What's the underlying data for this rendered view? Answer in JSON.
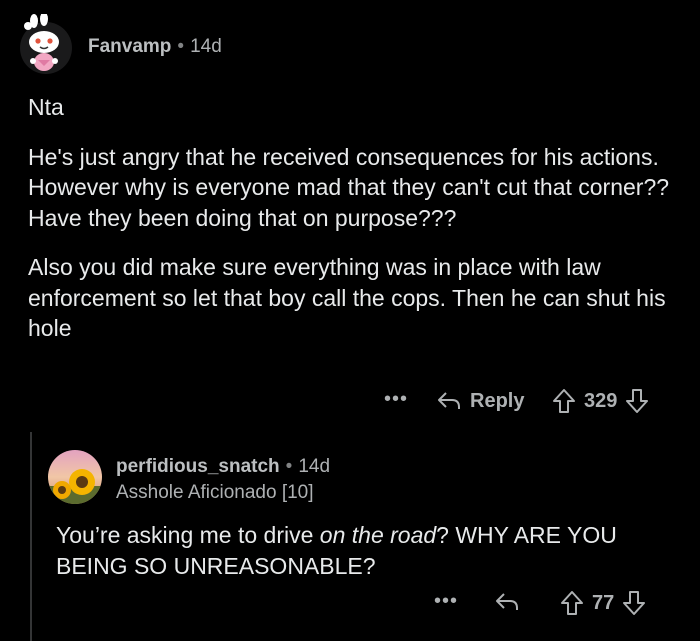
{
  "comment": {
    "username": "Fanvamp",
    "age": "14d",
    "paragraphs": [
      "Nta",
      "He's just angry that he received consequences for his actions. However why is everyone  mad that they can't cut that corner?? Have they been doing that on purpose???",
      "Also you did make sure everything was in place with law enforcement so let that boy call the cops. Then he can shut his hole"
    ],
    "more_label": "•••",
    "reply_label": "Reply",
    "score": "329"
  },
  "reply": {
    "username": "perfidious_snatch",
    "age": "14d",
    "flair": "Asshole Aficionado [10]",
    "body_before": "You’re asking me to drive ",
    "body_italic": "on the road",
    "body_after": "? WHY ARE YOU BEING SO UNREASONABLE?",
    "more_label": "•••",
    "score": "77"
  },
  "meta_separator": "•",
  "colors": {
    "background": "#000000",
    "text": "#e8eaeb",
    "muted": "#aeb1b3",
    "thread_line": "#343536"
  },
  "icons": [
    "reddit-snoo-avatar-icon",
    "sunflower-avatar-icon",
    "reply-arrow-icon",
    "upvote-arrow-icon",
    "downvote-arrow-icon"
  ]
}
